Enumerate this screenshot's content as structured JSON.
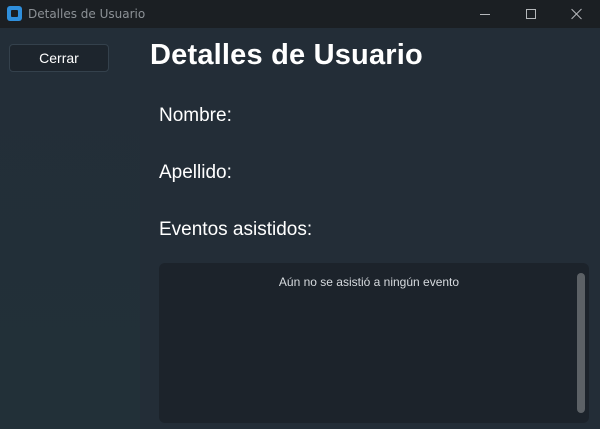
{
  "window": {
    "title": "Detalles de Usuario",
    "controls": [
      "minimize",
      "maximize",
      "close"
    ]
  },
  "sidebar": {
    "close_label": "Cerrar"
  },
  "main": {
    "title": "Detalles de Usuario",
    "fields": {
      "nombre_label": "Nombre:",
      "apellido_label": "Apellido:",
      "eventos_label": "Eventos asistidos:"
    },
    "events_panel": {
      "empty_message": "Aún no se asistió a ningún evento"
    }
  },
  "colors": {
    "titlebar_bg": "#1b1f23",
    "window_bg": "#232d37",
    "panel_bg": "#1c232b",
    "accent_icon": "#2f8fdc",
    "text": "#ffffff"
  }
}
